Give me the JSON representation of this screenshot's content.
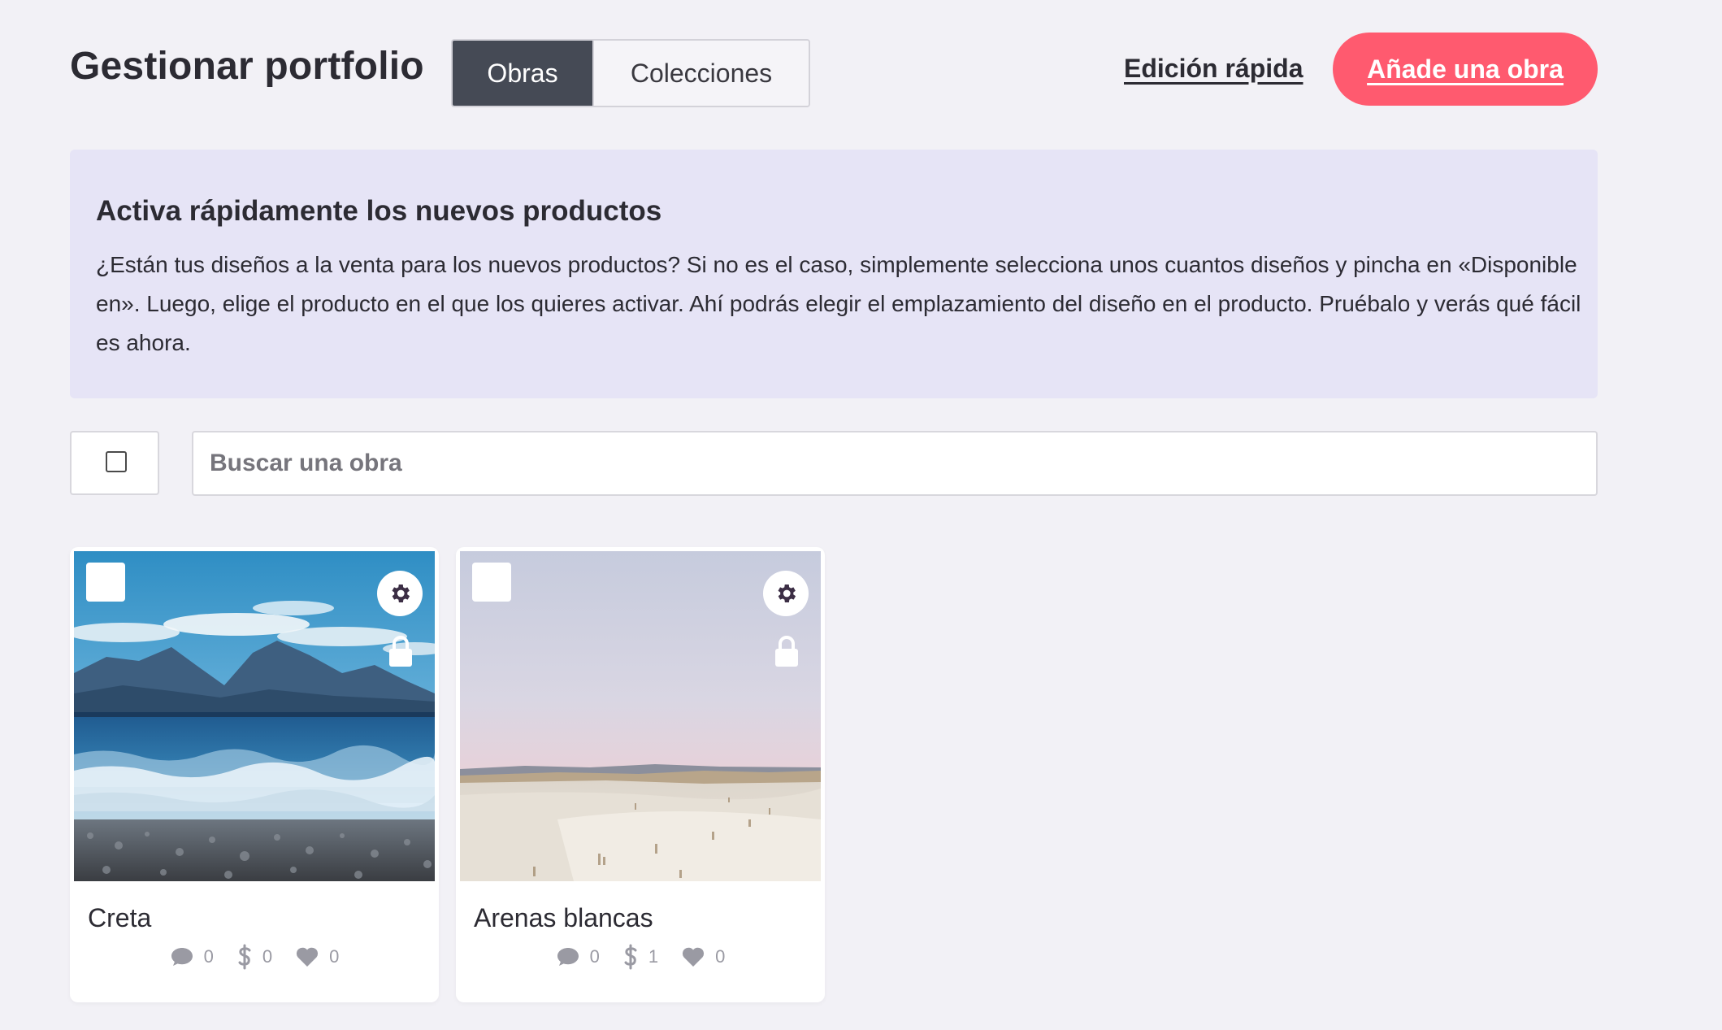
{
  "header": {
    "title": "Gestionar portfolio",
    "tabs": [
      {
        "label": "Obras",
        "active": true
      },
      {
        "label": "Colecciones",
        "active": false
      }
    ],
    "quick_edit_label": "Edición rápida",
    "add_button_label": "Añade una obra"
  },
  "banner": {
    "title": "Activa rápidamente los nuevos productos",
    "text": "¿Están tus diseños a la venta para los nuevos productos? Si no es el caso, simplemente selecciona unos cuantos diseños y pincha en «Disponible en». Luego, elige el producto en el que los quieres activar. Ahí podrás elegir el emplazamiento del diseño en el producto. Pruébalo y verás qué fácil es ahora."
  },
  "search": {
    "placeholder": "Buscar una obra",
    "value": ""
  },
  "works": [
    {
      "title": "Creta",
      "comments": "0",
      "sales": "0",
      "likes": "0",
      "locked": true,
      "image": "sea-mountains"
    },
    {
      "title": "Arenas blancas",
      "comments": "0",
      "sales": "1",
      "likes": "0",
      "locked": true,
      "image": "white-sand-dunes"
    }
  ],
  "colors": {
    "background": "#f2f1f6",
    "accent": "#ff5a6f",
    "tab_active": "#454a55",
    "banner": "#e6e4f6",
    "stat_icon": "#9a9aa3"
  },
  "icons": [
    "gear-icon",
    "lock-icon",
    "comment-icon",
    "dollar-icon",
    "heart-icon"
  ]
}
